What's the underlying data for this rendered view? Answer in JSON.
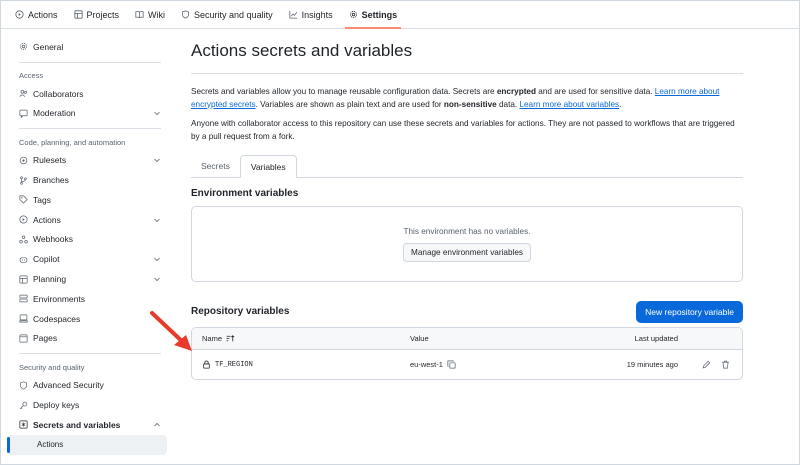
{
  "topnav": {
    "tabs": [
      {
        "label": "Actions",
        "icon": "play-circle-icon"
      },
      {
        "label": "Projects",
        "icon": "table-icon"
      },
      {
        "label": "Wiki",
        "icon": "book-icon"
      },
      {
        "label": "Security and quality",
        "icon": "shield-icon"
      },
      {
        "label": "Insights",
        "icon": "graph-icon"
      },
      {
        "label": "Settings",
        "icon": "gear-icon",
        "active": true
      }
    ]
  },
  "sidebar": {
    "general": "General",
    "access_heading": "Access",
    "collaborators": "Collaborators",
    "moderation": "Moderation",
    "code_heading": "Code, planning, and automation",
    "rulesets": "Rulesets",
    "branches": "Branches",
    "tags": "Tags",
    "actions": "Actions",
    "webhooks": "Webhooks",
    "copilot": "Copilot",
    "planning": "Planning",
    "environments": "Environments",
    "codespaces": "Codespaces",
    "pages": "Pages",
    "security_heading": "Security and quality",
    "advanced_security": "Advanced Security",
    "deploy_keys": "Deploy keys",
    "secrets_and_variables": "Secrets and variables",
    "secrets_sub_actions": "Actions"
  },
  "main": {
    "title": "Actions secrets and variables",
    "p1_a": "Secrets and variables allow you to manage reusable configuration data. Secrets are ",
    "p1_b": "encrypted",
    "p1_c": " and are used for sensitive data. ",
    "p1_link1": "Learn more about encrypted secrets",
    "p1_d": ". Variables are shown as plain text and are used for ",
    "p1_e": "non-sensitive",
    "p1_f": " data. ",
    "p1_link2": "Learn more about variables",
    "p1_g": ".",
    "p2": "Anyone with collaborator access to this repository can use these secrets and variables for actions. They are not passed to workflows that are triggered by a pull request from a fork.",
    "tabs": [
      "Secrets",
      "Variables"
    ],
    "env_title": "Environment variables",
    "env_empty": "This environment has no variables.",
    "env_button": "Manage environment variables",
    "repo_title": "Repository variables",
    "new_button": "New repository variable",
    "table": {
      "col_name": "Name",
      "col_value": "Value",
      "col_updated": "Last updated",
      "rows": [
        {
          "name": "TF_REGION",
          "value": "eu-west-1",
          "updated": "19 minutes ago"
        }
      ]
    }
  },
  "colors": {
    "accent": "#0969da",
    "tab_underline": "#fd8c73",
    "annotation_arrow": "#e8392b"
  }
}
